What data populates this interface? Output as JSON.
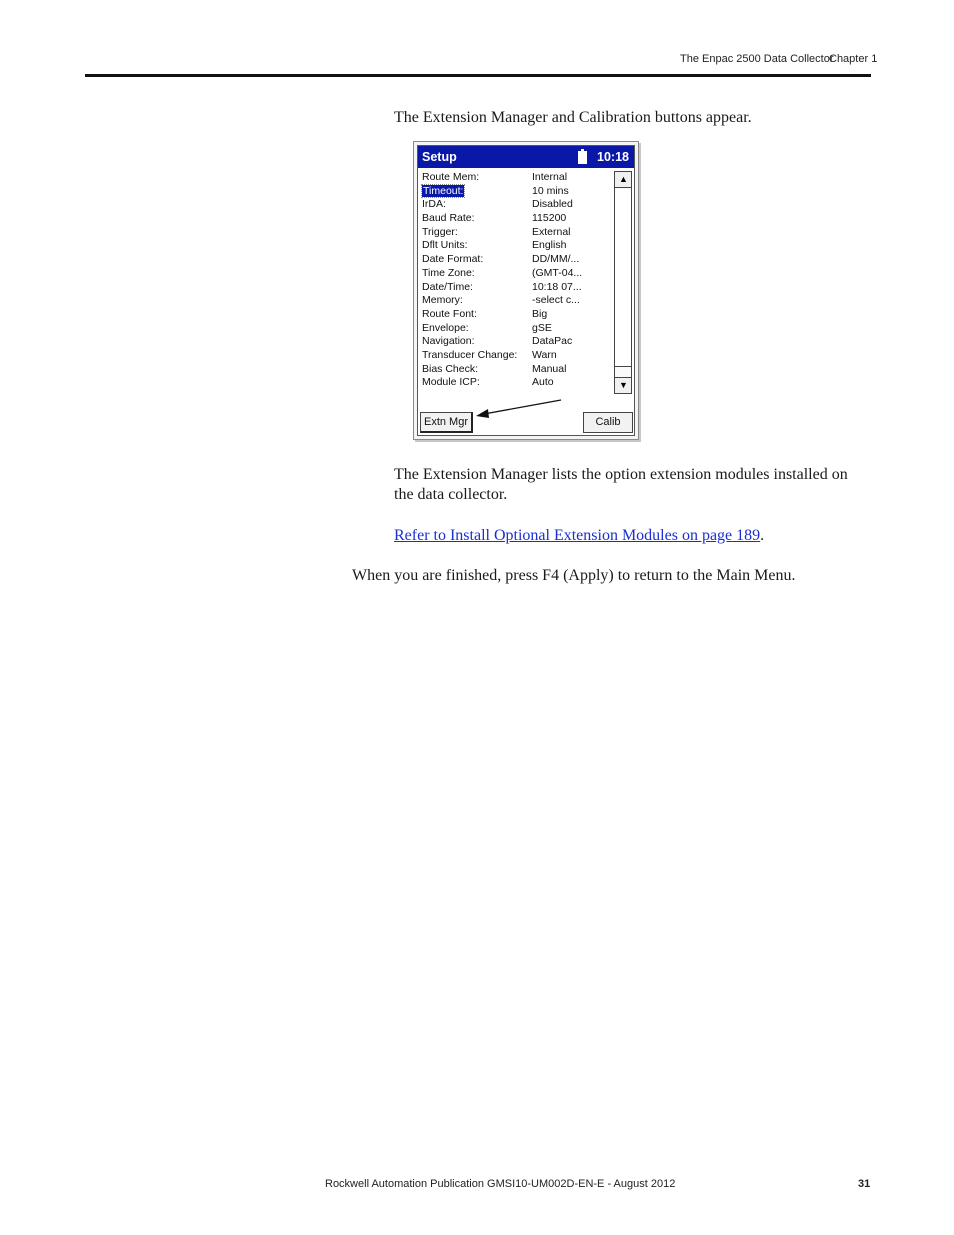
{
  "header": {
    "doc_title": "The Enpac 2500 Data Collector",
    "chapter": "Chapter 1"
  },
  "intro": "The Extension Manager and Calibration buttons appear.",
  "device": {
    "title": "Setup",
    "clock": "10:18",
    "rows": [
      {
        "label": "Route Mem:",
        "value": "Internal"
      },
      {
        "label": "Timeout:",
        "value": "10 mins"
      },
      {
        "label": "IrDA:",
        "value": "Disabled"
      },
      {
        "label": "Baud Rate:",
        "value": "115200"
      },
      {
        "label": "Trigger:",
        "value": "External"
      },
      {
        "label": "Dflt Units:",
        "value": "English"
      },
      {
        "label": "Date Format:",
        "value": "DD/MM/..."
      },
      {
        "label": "Time Zone:",
        "value": "(GMT-04..."
      },
      {
        "label": "Date/Time:",
        "value": "10:18 07..."
      },
      {
        "label": "Memory:",
        "value": "-select c..."
      },
      {
        "label": "Route Font:",
        "value": "Big"
      },
      {
        "label": "Envelope:",
        "value": "gSE"
      },
      {
        "label": "Navigation:",
        "value": "DataPac"
      },
      {
        "label": "Transducer Change:",
        "value": "Warn"
      },
      {
        "label": "Bias Check:",
        "value": "Manual"
      },
      {
        "label": "Module ICP:",
        "value": "Auto"
      }
    ],
    "extn_button": "Extn Mgr",
    "calib_button": "Calib"
  },
  "para1_line1": "The Extension Manager lists the option extension modules installed on",
  "para1_line2": "the data collector.",
  "link_text": "Refer to Install Optional Extension Modules on page 189",
  "link_suffix": ".",
  "para2": "When you are finished, press F4 (Apply) to return to the Main Menu.",
  "footer": {
    "publication": "Rockwell Automation Publication GMSI10-UM002D-EN-E - August 2012",
    "page_number": "31"
  }
}
